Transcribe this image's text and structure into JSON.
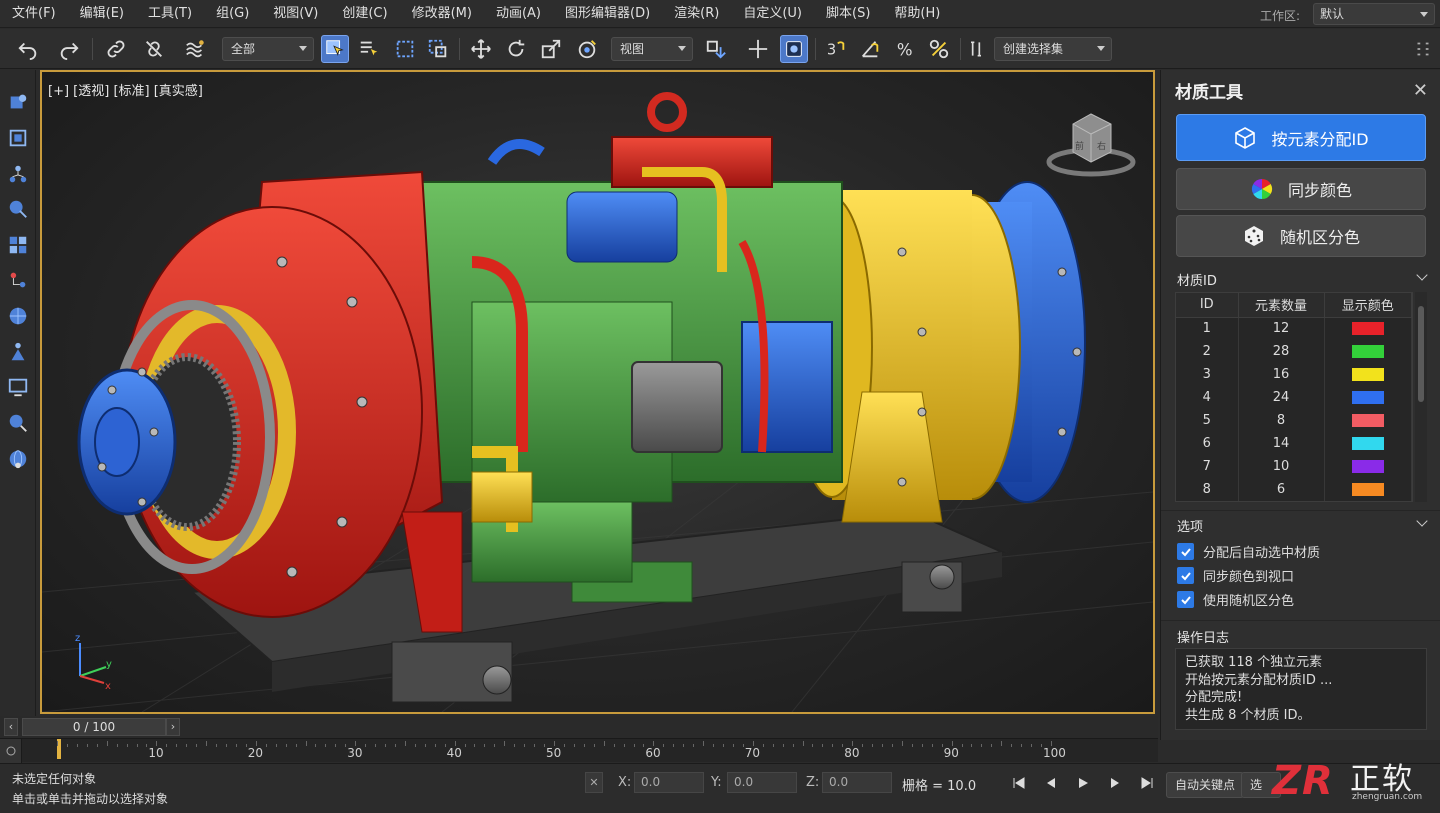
{
  "menu": [
    "文件(F)",
    "编辑(E)",
    "工具(T)",
    "组(G)",
    "视图(V)",
    "创建(C)",
    "修改器(M)",
    "动画(A)",
    "图形编辑器(D)",
    "渲染(R)",
    "自定义(U)",
    "脚本(S)",
    "帮助(H)"
  ],
  "workspace": {
    "label": "工作区:",
    "value": "默认"
  },
  "toolbar": {
    "filter": "全部",
    "ref_coord": "视图",
    "selection_set": "创建选择集"
  },
  "viewport": {
    "label": "[+] [透视] [标准] [真实感]",
    "cube_front": "前",
    "cube_right": "右"
  },
  "panel": {
    "title": "材质工具",
    "btn_assign": "按元素分配ID",
    "btn_sync": "同步颜色",
    "btn_random": "随机区分色",
    "matid_header": "材质ID",
    "columns": [
      "ID",
      "元素数量",
      "显示颜色"
    ],
    "rows": [
      {
        "id": "1",
        "count": "12",
        "color": "#e8222a"
      },
      {
        "id": "2",
        "count": "28",
        "color": "#33d13a"
      },
      {
        "id": "3",
        "count": "16",
        "color": "#f2e21c"
      },
      {
        "id": "4",
        "count": "24",
        "color": "#2f6ff0"
      },
      {
        "id": "5",
        "count": "8",
        "color": "#f25c63"
      },
      {
        "id": "6",
        "count": "14",
        "color": "#31d8ee"
      },
      {
        "id": "7",
        "count": "10",
        "color": "#8a2be8"
      },
      {
        "id": "8",
        "count": "6",
        "color": "#f68a22"
      }
    ],
    "options_header": "选项",
    "options": [
      "分配后自动选中材质",
      "同步颜色到视口",
      "使用随机区分色"
    ],
    "log_header": "操作日志",
    "log": [
      "已获取 118 个独立元素",
      "开始按元素分配材质ID ...",
      "分配完成!",
      "共生成 8 个材质 ID。"
    ]
  },
  "timeline": {
    "frame": "0 / 100",
    "ticks": [
      "10",
      "20",
      "30",
      "40",
      "50",
      "60",
      "70",
      "80",
      "90",
      "100"
    ]
  },
  "status": {
    "line1": "未选定任何对象",
    "line2": "单击或单击并拖动以选择对象",
    "x_label": "X:",
    "x_value": "0.0",
    "y_label": "Y:",
    "y_value": "0.0",
    "z_label": "Z:",
    "z_value": "0.0",
    "grid": "栅格 = 10.0",
    "autokey": "自动关键点",
    "selected": "选定"
  },
  "watermark": {
    "brand": "正软",
    "url": "zhengruan.com"
  }
}
